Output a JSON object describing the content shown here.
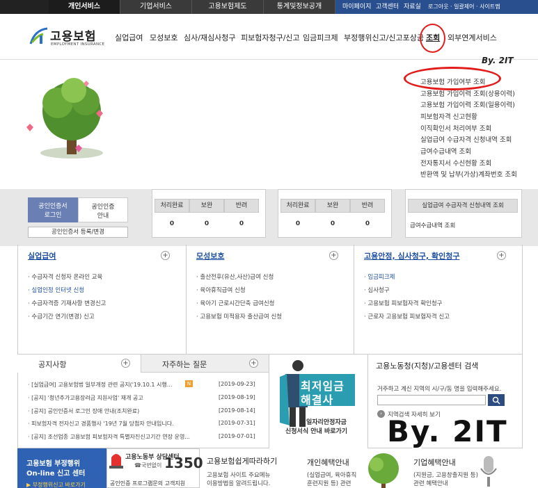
{
  "top_tabs": [
    "개인서비스",
    "기업서비스",
    "고용보험제도",
    "통계및정보공개"
  ],
  "utility": {
    "mypage": "마이페이지",
    "center": "고객센터",
    "library": "자료실",
    "login": "로그아웃 · 일괄제어 · 사이트맵"
  },
  "logo": {
    "title": "고용보험",
    "subtitle": "EMPLOYMENT INSURANCE"
  },
  "gnb": [
    "실업급여",
    "모성보호",
    "심사/재심사청구",
    "피보험자청구/신고",
    "임금피크제",
    "부정행위신고/신고포상금",
    "조회",
    "외부연계서비스"
  ],
  "watermark_small": "By. 2IT",
  "submenu": [
    "고용보험 가입여부 조회",
    "고용보험 가입이력 조회(상용이력)",
    "고용보험 가입이력 조회(일용이력)",
    "피보험자격 신고현황",
    "이직확인서 처리여부 조회",
    "실업급여 수급자격 신청내역 조회",
    "급여수급내역 조회",
    "전자통지서 수신현황 조회",
    "반환액 및 납부(가상)계좌번호 조회"
  ],
  "cert": {
    "login": "공인인증서\n로그인",
    "guide": "공인인증\n안내",
    "register": "공인인증서 등록/변경"
  },
  "status_headers": [
    "처리완료",
    "보완",
    "반려"
  ],
  "status_values": [
    "0",
    "0",
    "0"
  ],
  "status_headers2": [
    "처리완료",
    "보완",
    "반려"
  ],
  "status_values2": [
    "0",
    "0",
    "0"
  ],
  "links_box": [
    "실업급여 수급자격 신청내역 조회",
    "급여수급내역 조회"
  ],
  "sections": [
    {
      "title": "실업급여",
      "items": [
        "수급자격 신청자 온라인 교육",
        "실업인정 인터넷 신청",
        "수급자격증 기재사항 변경신고",
        "수급기간 연기(변경) 신고"
      ]
    },
    {
      "title": "모성보호",
      "items": [
        "출산전후(유산,사산)급여 신청",
        "육아휴직급여 신청",
        "육아기 근로시간단축 급여신청",
        "고용보험 미적용자 출산급여 신청"
      ]
    },
    {
      "title": "고용안정, 심사청구, 확인청구",
      "items": [
        "임금피크제",
        "심사청구",
        "고용보험 피보험자격 확인청구",
        "근로자 고용보험 피보험자격 신고"
      ]
    }
  ],
  "notice": {
    "tab1": "공지사항",
    "tab2": "자주하는 질문",
    "rows": [
      {
        "text": "[실업급여] 고용보험법 일부개정 관련 공지('19.10.1 시행...",
        "date": "[2019-09-23]"
      },
      {
        "text": "[공지] '청년추가고용장려금 지원사업' 재개 공고",
        "date": "[2019-08-19]"
      },
      {
        "text": "[공지] 공인인증서 로그인 장애 안내(조치완료)",
        "date": "[2019-08-14]"
      },
      {
        "text": "피보험자격 전자신고 경품행사 '19년 7월 당첨자 안내입니다.",
        "date": "[2019-07-31]"
      },
      {
        "text": "[공지] 조선업종 고용보험 피보험자격 특별자진신고기간 연장 운영...",
        "date": "[2019-07-01]"
      }
    ],
    "new_badge": "N"
  },
  "banner": {
    "title1": "최저임금",
    "title2": "해결사",
    "sub1": "일자리안정자금",
    "sub2": "신청서식 안내 바로가기"
  },
  "search": {
    "title": "고용노동청(지청)/고용센터 검색",
    "desc": "거주하고 계신 지역의 시/구/동 명을 입력해주세요.",
    "more": "지역검색 자세히 보기"
  },
  "watermark_big": "By. 2IT",
  "bottom": {
    "report1": "고용보험 부정행위",
    "report2": "On-line 신고 센터",
    "report3": "▶ 부정행위신고 바로가기",
    "call_title": "고용노동부 상담센터",
    "call_num": "1350",
    "call_sub": "☎국번없이",
    "call_note": "공인인증 프로그램문의 고객지원",
    "easy_title": "고용보험쉽게따라하기",
    "easy1": "고용보험 사이트 주요메뉴",
    "easy2": "이용방법을 알려드립니다.",
    "indiv_title": "개인혜택안내",
    "indiv1": "(실업급여, 육아휴직",
    "indiv2": "훈련지원 등) 관련",
    "biz_title": "기업혜택안내",
    "biz1": "(지원금, 고용창출지원 등)",
    "biz2": "관련 혜택안내"
  },
  "colors": {
    "accent": "#1d4fa0",
    "topbar": "#222222",
    "circle": "#e21b1b",
    "bottom_blue": "#2f62b3"
  }
}
